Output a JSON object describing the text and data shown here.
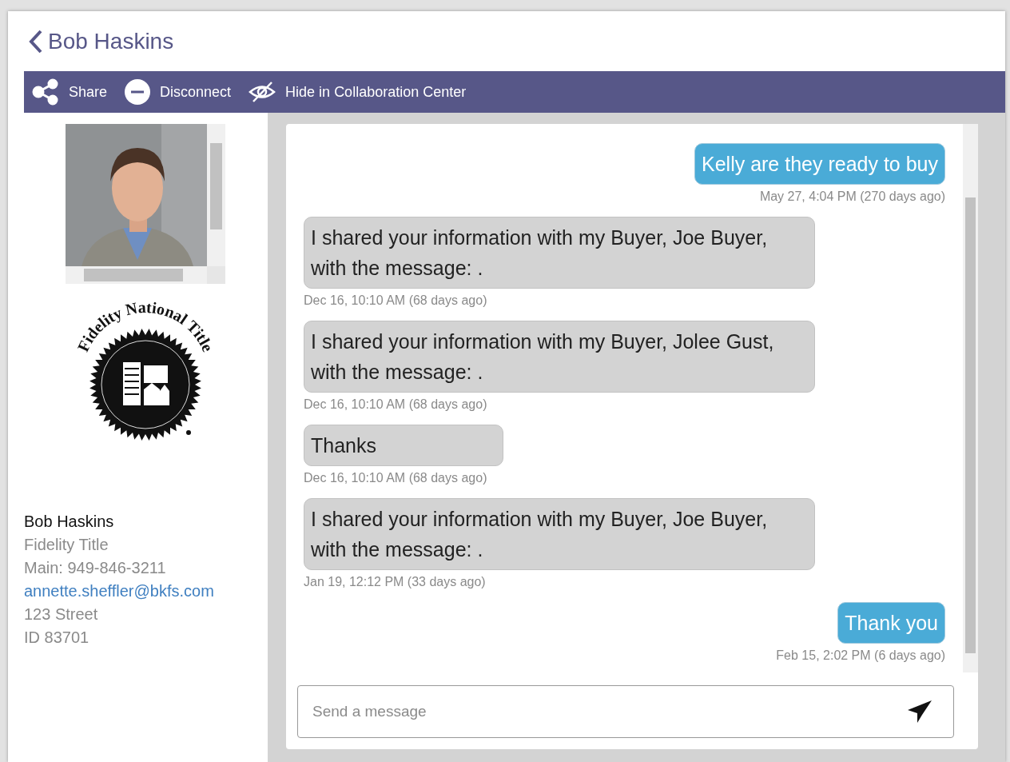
{
  "header": {
    "title": "Bob Haskins"
  },
  "toolbar": [
    {
      "kind": "share",
      "label": "Share"
    },
    {
      "kind": "disconnect",
      "label": "Disconnect"
    },
    {
      "kind": "hide",
      "label": "Hide in Collaboration Center"
    }
  ],
  "profile": {
    "logo_text": "Fidelity National Title",
    "name": "Bob Haskins",
    "company": "Fidelity Title",
    "phone": "Main: 949-846-3211",
    "email": "annette.sheffler@bkfs.com",
    "address_line_1": "123 Street",
    "address_line_2": "ID 83701"
  },
  "messages": [
    {
      "kind": "sent",
      "text": "Kelly are they ready to buy",
      "time": "May 27, 4:04 PM (270 days ago)"
    },
    {
      "kind": "received",
      "text": "I shared your information with my Buyer, Joe Buyer, with the message: .",
      "time": "Dec 16, 10:10 AM (68 days ago)"
    },
    {
      "kind": "received",
      "text": "I shared your information with my Buyer, Jolee Gust, with the message: .",
      "time": "Dec 16, 10:10 AM (68 days ago)"
    },
    {
      "kind": "received",
      "text": "Thanks",
      "time": "Dec 16, 10:10 AM (68 days ago)"
    },
    {
      "kind": "received",
      "text": "I shared your information with my Buyer, Joe Buyer, with the message: .",
      "time": "Jan 19, 12:12 PM (33 days ago)"
    },
    {
      "kind": "sent",
      "text": "Thank you",
      "time": "Feb 15, 2:02 PM (6 days ago)"
    }
  ],
  "composer": {
    "placeholder": "Send a message"
  }
}
